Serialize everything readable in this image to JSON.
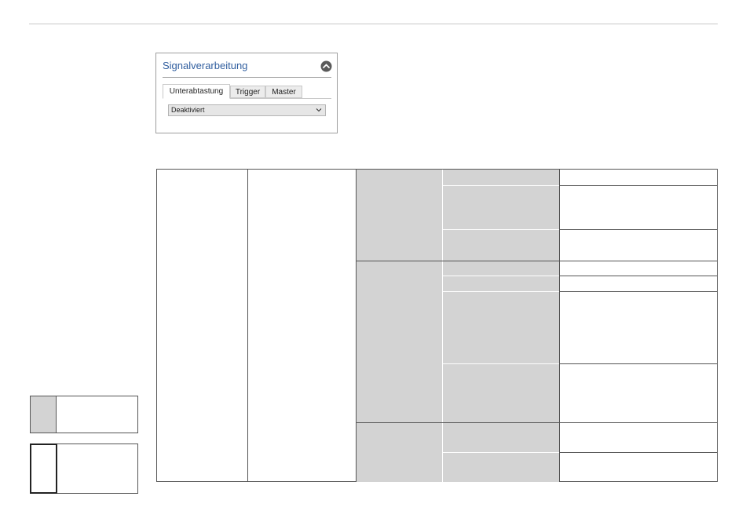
{
  "panel": {
    "title": "Signalverarbeitung",
    "collapse_icon": "chevron-up-circle-icon",
    "tabs": [
      {
        "label": "Unterabtastung",
        "active": true
      },
      {
        "label": "Trigger",
        "active": false
      },
      {
        "label": "Master",
        "active": false
      }
    ],
    "select": {
      "value": "Deaktiviert",
      "icon": "chevron-down-icon"
    }
  },
  "colors": {
    "title": "#2f5d9e",
    "cell_gray": "#d3d3d3",
    "border": "#555555"
  }
}
